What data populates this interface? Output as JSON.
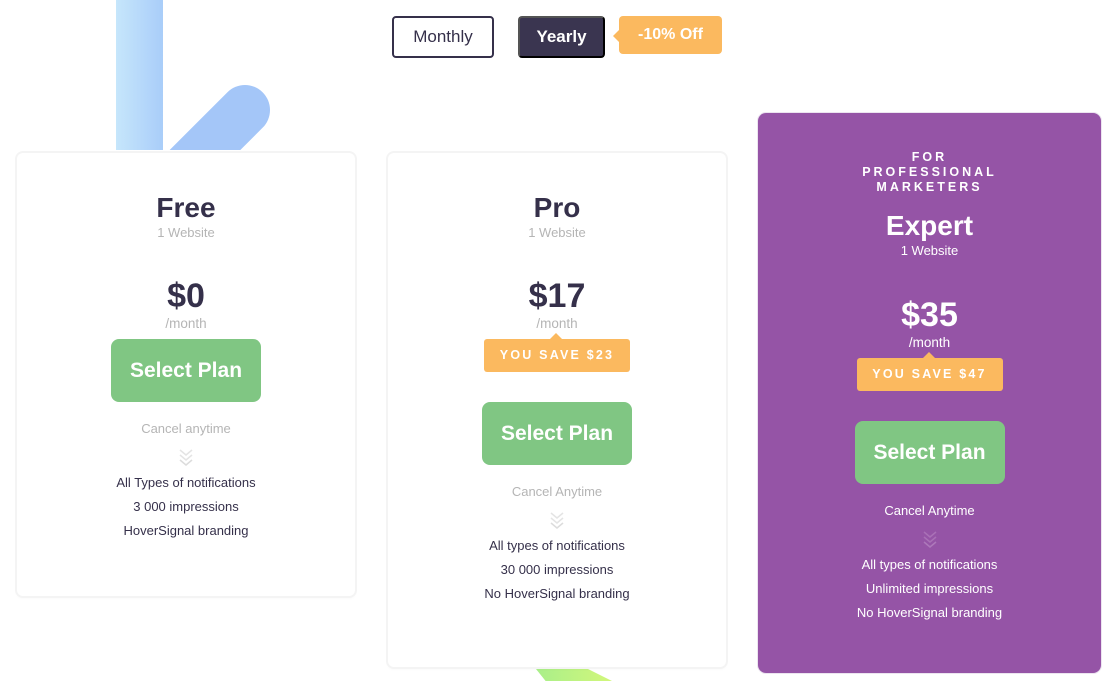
{
  "billing_toggle": {
    "options": [
      "Monthly",
      "Yearly"
    ],
    "selected": "Yearly",
    "discount_badge": "-10% Off"
  },
  "colors": {
    "dark": "#35304a",
    "accent_purple": "#9554a6",
    "cta_green": "#80c683",
    "badge_orange": "#fbb95f"
  },
  "plans": [
    {
      "name": "Free",
      "sites": "1 Website",
      "price": "$0",
      "period": "/month",
      "cta": "Select Plan",
      "cancel_note": "Cancel anytime",
      "features": [
        "All Types of notifications",
        "3 000 impressions",
        "HoverSignal branding"
      ]
    },
    {
      "name": "Pro",
      "sites": "1 Website",
      "price": "$17",
      "period": "/month",
      "save_badge": "YOU SAVE $23",
      "cta": "Select Plan",
      "cancel_note": "Cancel Anytime",
      "features": [
        "All types of notifications",
        "30 000 impressions",
        "No HoverSignal branding"
      ]
    },
    {
      "eyebrow": "FOR PROFESSIONAL MARKETERS",
      "name": "Expert",
      "sites": "1 Website",
      "price": "$35",
      "period": "/month",
      "save_badge": "YOU SAVE $47",
      "cta": "Select Plan",
      "cancel_note": "Cancel Anytime",
      "features": [
        "All types of notifications",
        "Unlimited impressions",
        "No HoverSignal branding"
      ]
    }
  ]
}
